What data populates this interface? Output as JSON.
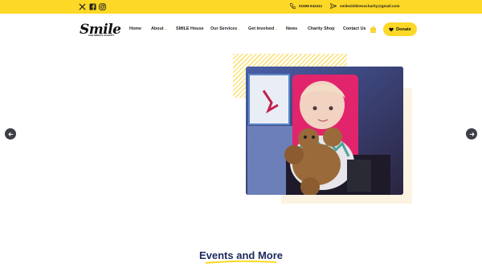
{
  "topbar": {
    "social": [
      {
        "icon": "x-twitter-icon"
      },
      {
        "icon": "facebook-icon"
      },
      {
        "icon": "instagram-icon"
      }
    ],
    "phone": "01698 642411",
    "email": "smilechildrenscharity@gmail.com",
    "background": "#fdd826"
  },
  "logo": {
    "word": "Smile",
    "sub": "CHILDREN'S CHARITY"
  },
  "nav": {
    "items": [
      {
        "label": "Home",
        "dropdown": false
      },
      {
        "label": "About",
        "dropdown": true
      },
      {
        "label": "SMILE House",
        "dropdown": false
      },
      {
        "label": "Our Services",
        "dropdown": true
      },
      {
        "label": "Get Involved",
        "dropdown": true
      },
      {
        "label": "News",
        "dropdown": false
      },
      {
        "label": "Charity Shop",
        "dropdown": false
      },
      {
        "label": "Contact Us",
        "dropdown": false
      }
    ],
    "donate_label": "Donate",
    "caret": "⌄"
  },
  "hero": {
    "image_alt_icon": "photo-child-with-teddy-bear",
    "prev_icon": "arrow-left-icon",
    "next_icon": "arrow-right-icon"
  },
  "events": {
    "title": "Events and More",
    "underline_color": "#fdd826"
  }
}
